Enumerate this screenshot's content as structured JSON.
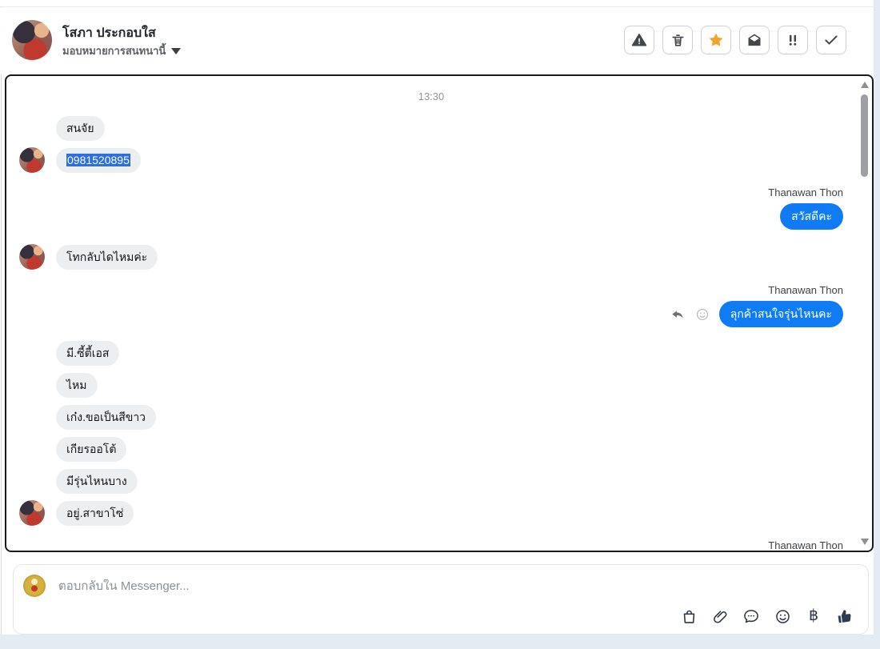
{
  "header": {
    "contact_name": "โสภา ประกอบใส",
    "assignment_label": "มอบหมายการสนทนานี้",
    "actions": [
      {
        "id": "report",
        "icon": "warning-triangle-icon"
      },
      {
        "id": "delete",
        "icon": "trash-icon"
      },
      {
        "id": "star",
        "icon": "star-icon",
        "active_color": "#F5A12E"
      },
      {
        "id": "mark-unread",
        "icon": "envelope-icon"
      },
      {
        "id": "mark-spam",
        "icon": "double-exclamation-icon"
      },
      {
        "id": "mark-done",
        "icon": "check-icon"
      }
    ]
  },
  "chat": {
    "timestamp": "13:30",
    "messages": [
      {
        "side": "left",
        "text": "สนจัย",
        "avatar": false
      },
      {
        "side": "left",
        "text": "0981520895",
        "avatar": true,
        "selected": true
      },
      {
        "side": "right",
        "sender": "Thanawan Thon",
        "text": "สวัสดีคะ"
      },
      {
        "side": "left",
        "text": "โทกลับไดไหมค่ะ",
        "avatar": true
      },
      {
        "side": "right",
        "sender": "Thanawan Thon",
        "text": "ลุกค้าสนใจรุ่นไหนคะ",
        "hover_actions": [
          "reply-icon",
          "add-reaction-icon"
        ]
      },
      {
        "side": "left",
        "text": "มี.ซี้ตี้เอส",
        "avatar": false
      },
      {
        "side": "left",
        "text": "ไหม",
        "avatar": false
      },
      {
        "side": "left",
        "text": "เก๋ง.ขอเป็นสีขาว",
        "avatar": false
      },
      {
        "side": "left",
        "text": "เกียรออโต้",
        "avatar": false
      },
      {
        "side": "left",
        "text": "มีรุ่นไหนบาง",
        "avatar": false
      },
      {
        "side": "left",
        "text": "อยู่.สาขาโซ่",
        "avatar": true
      },
      {
        "side": "right",
        "sender": "Thanawan Thon",
        "text": "",
        "partial": true
      }
    ]
  },
  "composer": {
    "placeholder": "ตอบกลับใน Messenger...",
    "baht_symbol": "฿",
    "icons": [
      "shopping-bag-icon",
      "paperclip-icon",
      "saved-replies-icon",
      "emoji-icon",
      "baht-icon",
      "like-icon"
    ]
  },
  "colors": {
    "outgoing_bubble": "#0F7CF5",
    "incoming_bubble": "#EDEEEF",
    "selection_highlight": "#2B70E0",
    "star_active": "#F5A12E",
    "chat_border": "#191A1C",
    "like_icon": "#2C3A52"
  }
}
